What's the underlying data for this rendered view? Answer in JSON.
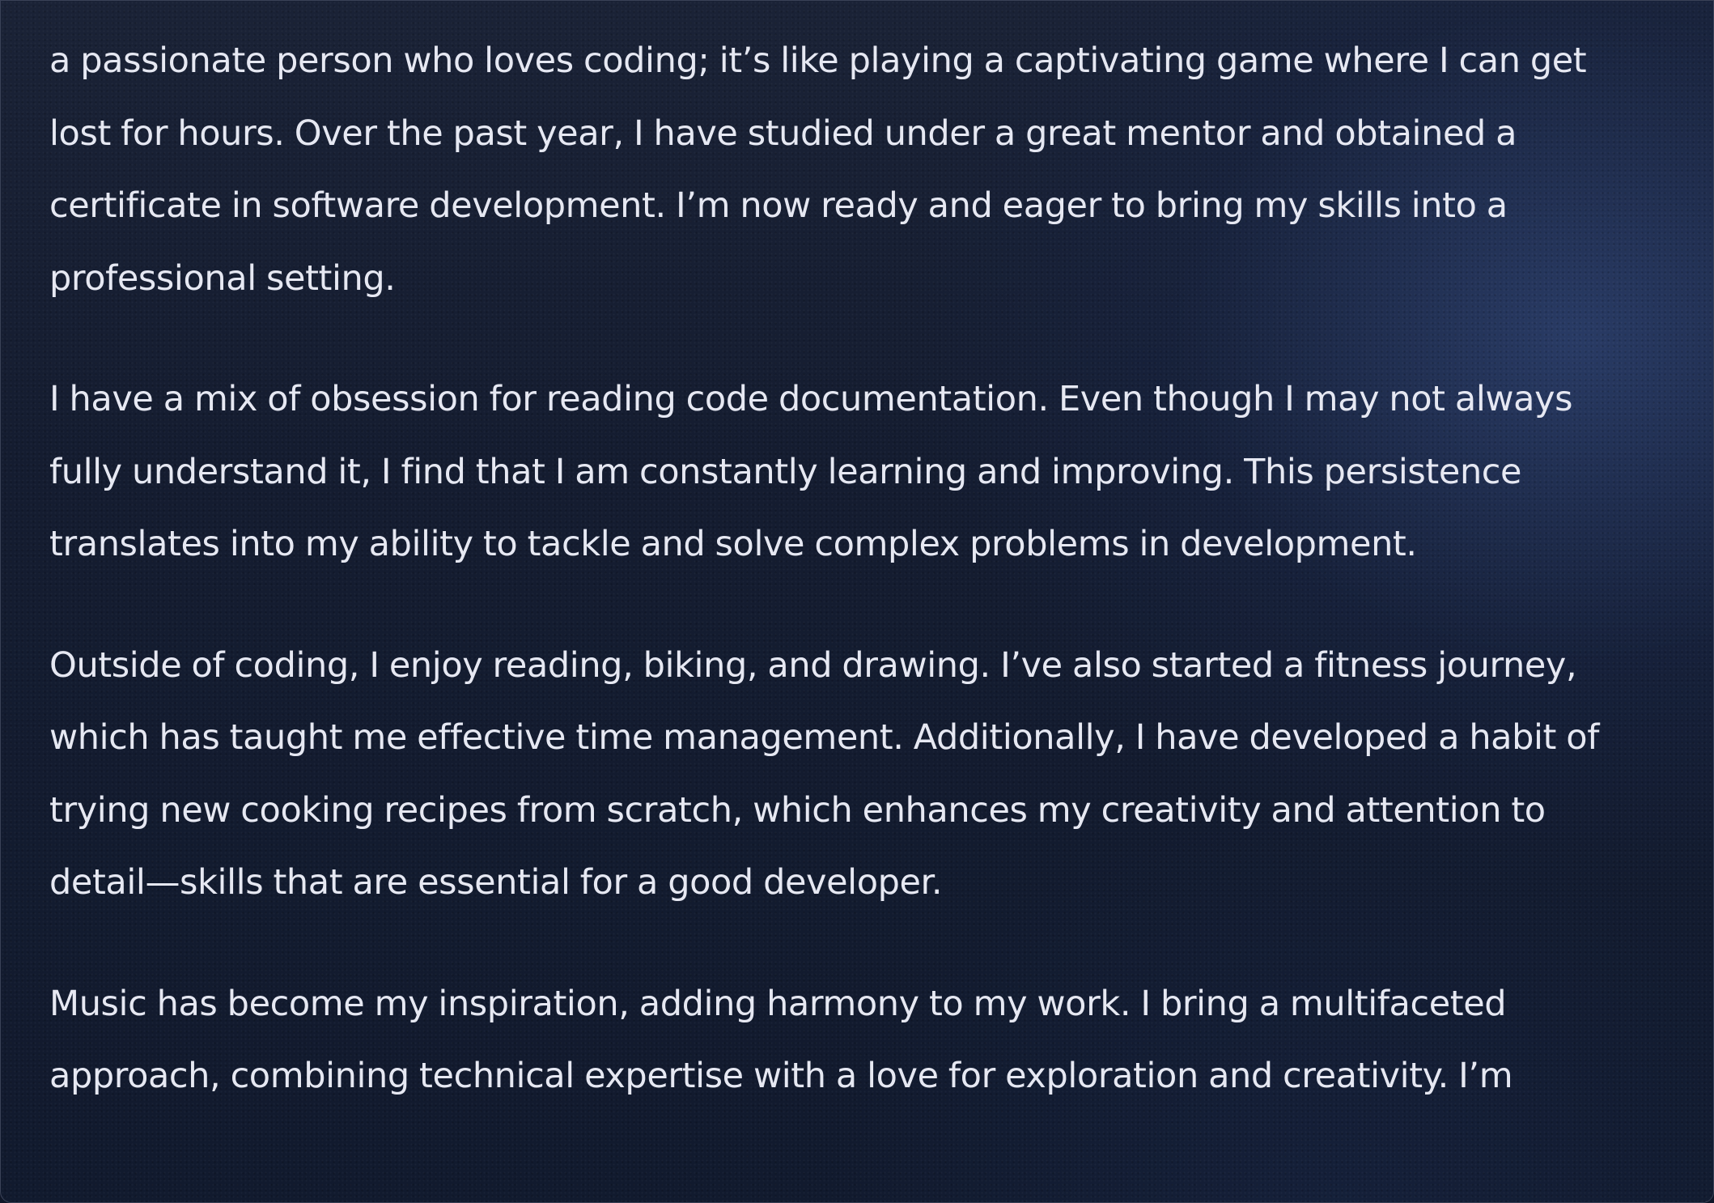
{
  "about": {
    "paragraphs": [
      "a passionate person who loves coding; it’s like playing a captivating game where I can get lost for hours. Over the past year, I have studied under a great mentor and obtained a certificate in software development. I’m now ready and eager to bring my skills into a professional setting.",
      "I have a mix of obsession for reading code documentation. Even though I may not always fully understand it, I find that I am constantly learning and improving. This persistence translates into my ability to tackle and solve complex problems in development.",
      "Outside of coding, I enjoy reading, biking, and drawing. I’ve also started a fitness journey, which has taught me effective time management. Additionally, I have developed a habit of trying new cooking recipes from scratch, which enhances my creativity and attention to detail—skills that are essential for a good developer.",
      "Music has become my inspiration, adding harmony to my work. I bring a multifaceted approach, combining technical expertise with a love for exploration and creativity. I’m"
    ]
  },
  "colors": {
    "background": "#141c30",
    "text": "#e6e8f2",
    "border": "#3a4257"
  }
}
